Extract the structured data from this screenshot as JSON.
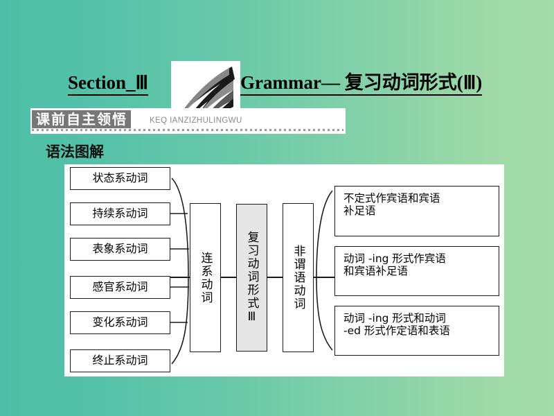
{
  "slide": {
    "background_left_color": "#4ebfa6",
    "background_right_color": "#a4dba8"
  },
  "title": {
    "left": "Section_Ⅲ",
    "right": "Grammar— 复习动词形式(Ⅲ)",
    "logo_alt": "swoosh-logo"
  },
  "banner": {
    "tag": "课前自主领悟",
    "pinyin": "KEQ IANZIZHULINGWU",
    "tag_bg_color": "#777777"
  },
  "subheading": "语法图解",
  "diagram": {
    "left_boxes": [
      {
        "label": "状态系动词"
      },
      {
        "label": "持续系动词"
      },
      {
        "label": "表象系动词"
      },
      {
        "label": "感官系动词"
      },
      {
        "label": "变化系动词"
      },
      {
        "label": "终止系动词"
      }
    ],
    "middle_boxes": [
      {
        "label": "连系动词",
        "highlight": false
      },
      {
        "label": "复习动词形式Ⅲ",
        "highlight": true,
        "highlight_color": "#e6e6e6"
      },
      {
        "label": "非谓语动词",
        "highlight": false
      }
    ],
    "right_boxes": [
      {
        "line1": "不定式作宾语和宾语",
        "line2": "补足语"
      },
      {
        "line1": "动词 -ing 形式作宾语",
        "line2": "和宾语补足语"
      },
      {
        "line1": "动词 -ing 形式和动词",
        "line2": "-ed 形式作定语和表语"
      }
    ]
  }
}
